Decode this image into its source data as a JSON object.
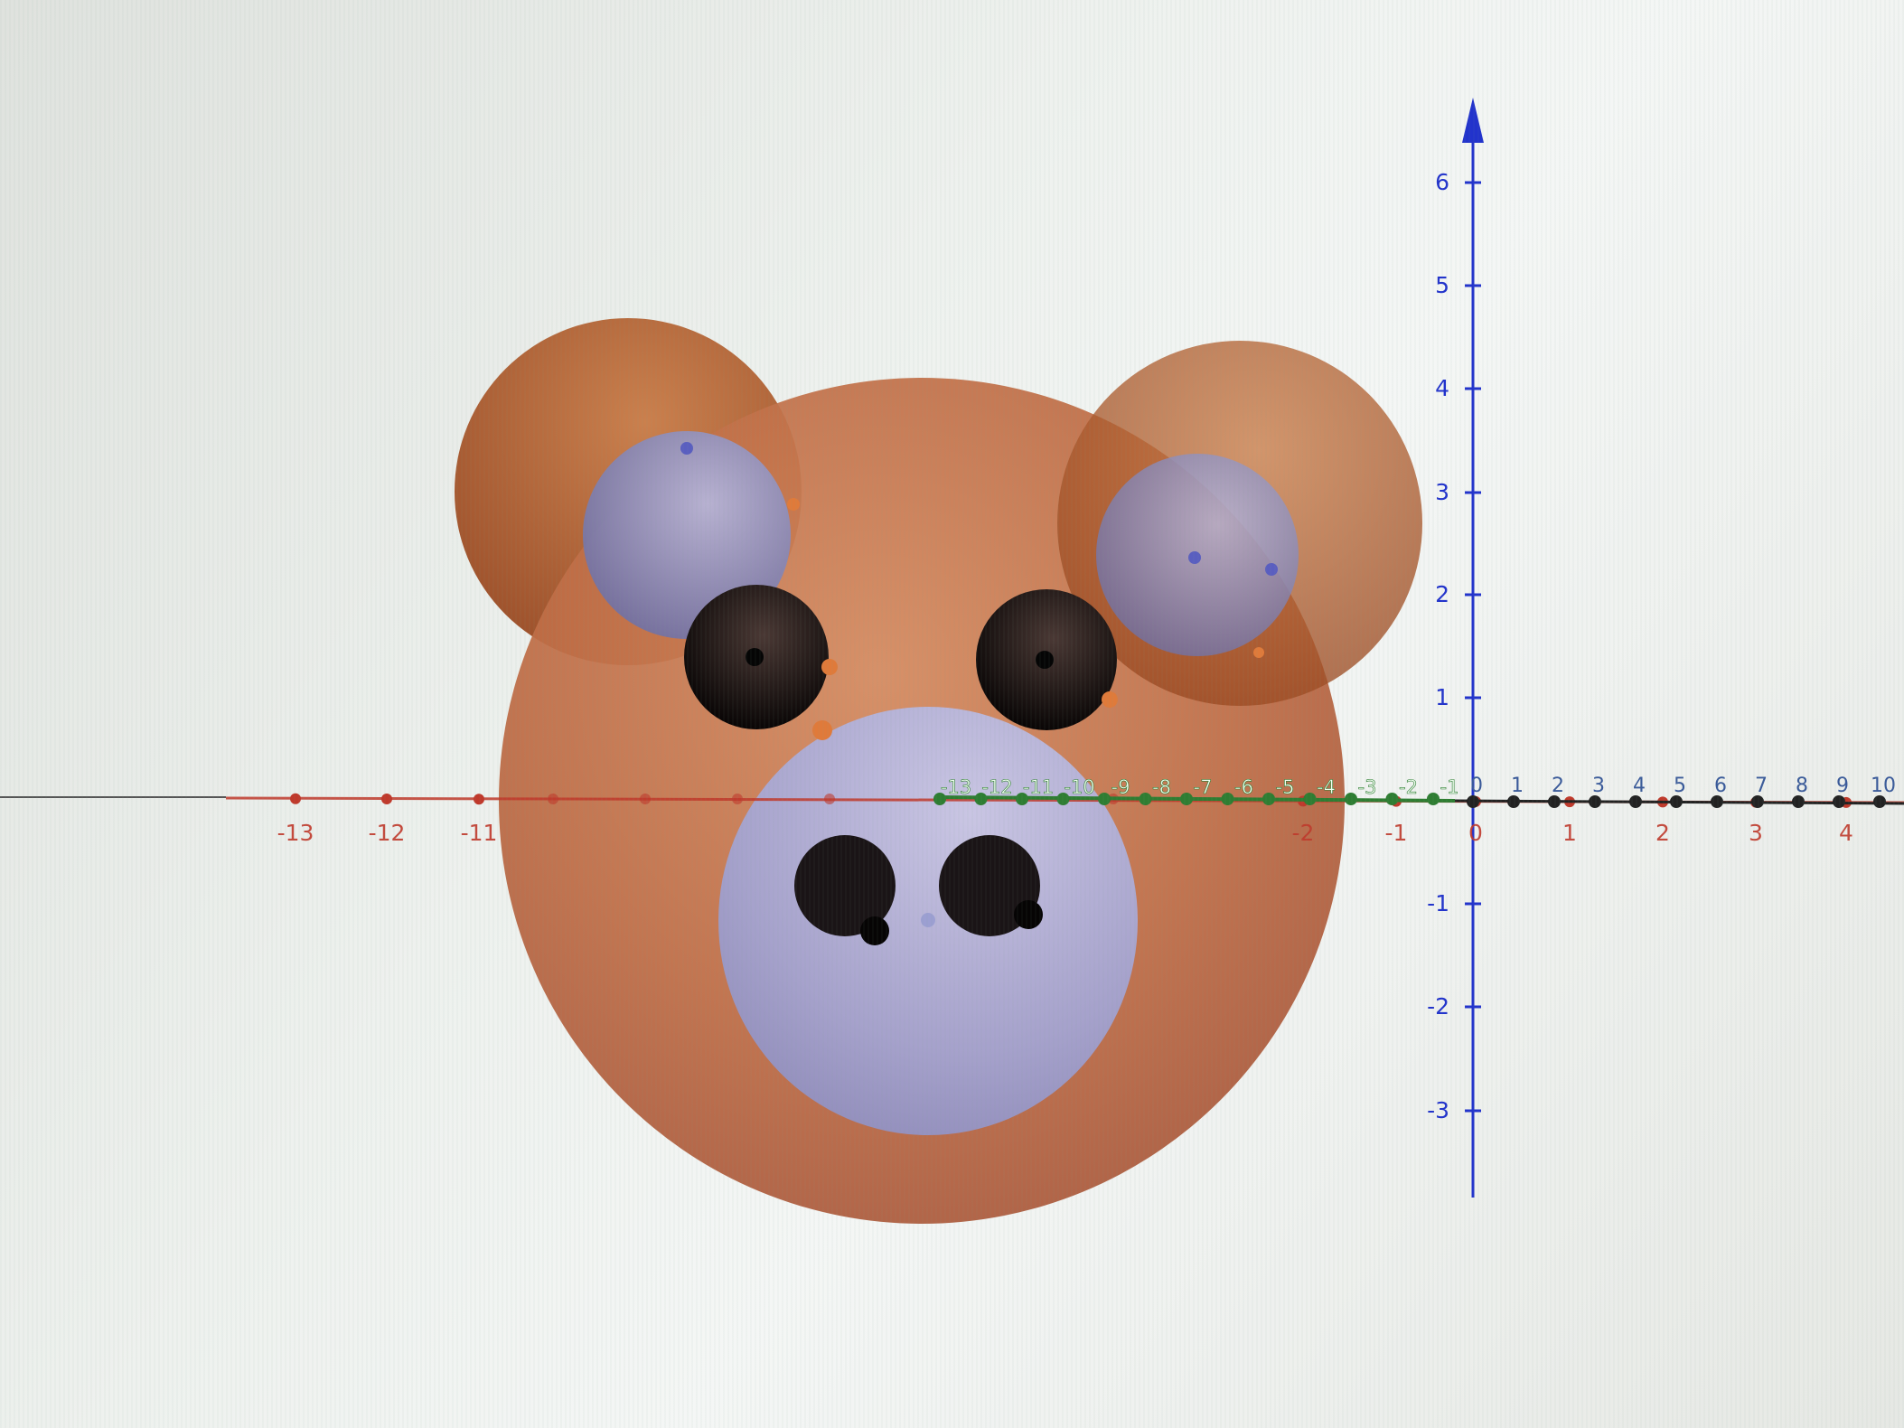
{
  "graph_view": {
    "y_axis": {
      "color": "#2233cc",
      "ticks": [
        "6",
        "5",
        "4",
        "3",
        "2",
        "1",
        "-1",
        "-2",
        "-3"
      ]
    },
    "x_axis_black": {
      "color": "#222222",
      "ticks": [
        "0",
        "1",
        "2",
        "3",
        "4",
        "5",
        "6",
        "7",
        "8",
        "9",
        "10"
      ]
    },
    "x_axis_red": {
      "color": "#c0392b",
      "ticks": [
        "-13",
        "-12",
        "-11",
        "-2",
        "-1",
        "0",
        "1",
        "2",
        "3",
        "4"
      ]
    },
    "x_axis_green": {
      "color": "#2e7d32",
      "ticks": [
        "-13",
        "-12",
        "-11",
        "-10",
        "-9",
        "-8",
        "-7",
        "-6",
        "-5",
        "-4",
        "-3",
        "-2",
        "-1"
      ]
    },
    "figure": {
      "description_icon": "pig-face-spheres",
      "colors": {
        "head": "#c0704a",
        "ear": "#b8632f",
        "inner_ear": "#8e8fc4",
        "snout": "#a6a8d8",
        "eye": "#111111",
        "nostril": "#111111",
        "highlight_point": "#e07a3a"
      }
    }
  }
}
